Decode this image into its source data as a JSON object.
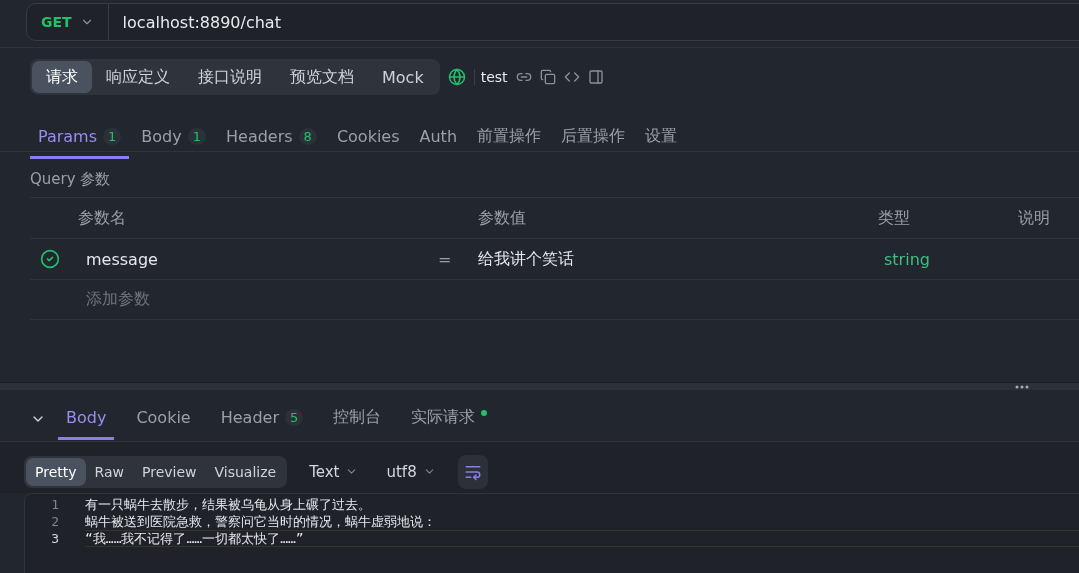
{
  "request": {
    "method": "GET",
    "url": "localhost:8890/chat"
  },
  "modes": [
    {
      "label": "请求",
      "selected": true
    },
    {
      "label": "响应定义",
      "selected": false
    },
    {
      "label": "接口说明",
      "selected": false
    },
    {
      "label": "预览文档",
      "selected": false
    },
    {
      "label": "Mock",
      "selected": false
    }
  ],
  "environment": "test",
  "param_tabs": [
    {
      "label": "Params",
      "count": "1",
      "selected": true
    },
    {
      "label": "Body",
      "count": "1",
      "selected": false
    },
    {
      "label": "Headers",
      "count": "8",
      "selected": false
    },
    {
      "label": "Cookies",
      "selected": false
    },
    {
      "label": "Auth",
      "selected": false
    },
    {
      "label": "前置操作",
      "selected": false
    },
    {
      "label": "后置操作",
      "selected": false
    },
    {
      "label": "设置",
      "selected": false
    }
  ],
  "query": {
    "title": "Query 参数",
    "columns": [
      "参数名",
      "参数值",
      "类型",
      "说明"
    ],
    "rows": [
      {
        "enabled": true,
        "name": "message",
        "equals": "=",
        "value": "给我讲个笑话",
        "type": "string"
      }
    ],
    "add_placeholder": "添加参数"
  },
  "response_tabs": [
    {
      "label": "Body",
      "selected": true
    },
    {
      "label": "Cookie",
      "selected": false
    },
    {
      "label": "Header",
      "count": "5",
      "selected": false
    },
    {
      "label": "控制台",
      "selected": false
    },
    {
      "label": "实际请求",
      "dot": true,
      "selected": false
    }
  ],
  "view_modes": [
    {
      "label": "Pretty",
      "selected": true
    },
    {
      "label": "Raw",
      "selected": false
    },
    {
      "label": "Preview",
      "selected": false
    },
    {
      "label": "Visualize",
      "selected": false
    }
  ],
  "format": "Text",
  "encoding": "utf8",
  "code_lines": [
    {
      "number": "1",
      "text": "有一只蜗牛去散步，结果被乌龟从身上碾了过去。",
      "current": false
    },
    {
      "number": "2",
      "text": "蜗牛被送到医院急救，警察问它当时的情况，蜗牛虚弱地说：",
      "current": false
    },
    {
      "number": "3",
      "text": "“我……我不记得了……一切都太快了……”",
      "current": true
    }
  ]
}
